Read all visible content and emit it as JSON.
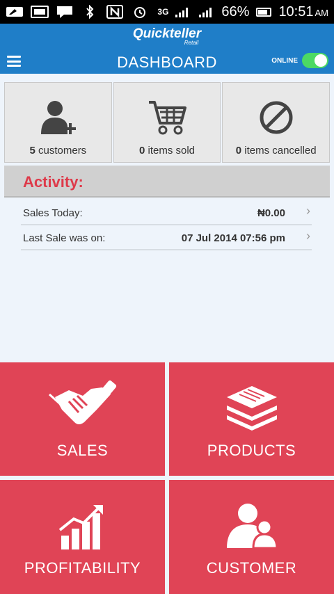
{
  "status_bar": {
    "battery": "66%",
    "time": "10:51",
    "ampm": "AM",
    "network": "3G"
  },
  "app": {
    "logo": "Quickteller",
    "logo_sub": "Retail",
    "title": "DASHBOARD",
    "online_label": "ONLINE",
    "online": true,
    "accent_color": "#1f7ec8",
    "tile_color": "#e04456"
  },
  "stats": [
    {
      "count": "5",
      "label": "customers",
      "icon": "add-user-icon"
    },
    {
      "count": "0",
      "label": "items sold",
      "icon": "cart-icon"
    },
    {
      "count": "0",
      "label": "items cancelled",
      "icon": "cancel-icon"
    }
  ],
  "activity": {
    "title": "Activity:",
    "rows": [
      {
        "label": "Sales Today:",
        "value": "₦0.00"
      },
      {
        "label": "Last Sale was on:",
        "value": "07 Jul 2014 07:56 pm"
      }
    ]
  },
  "tiles": [
    {
      "label": "SALES",
      "icon": "handshake-icon"
    },
    {
      "label": "PRODUCTS",
      "icon": "layers-icon"
    },
    {
      "label": "PROFITABILITY",
      "icon": "bar-chart-icon"
    },
    {
      "label": "CUSTOMER",
      "icon": "users-icon"
    }
  ]
}
